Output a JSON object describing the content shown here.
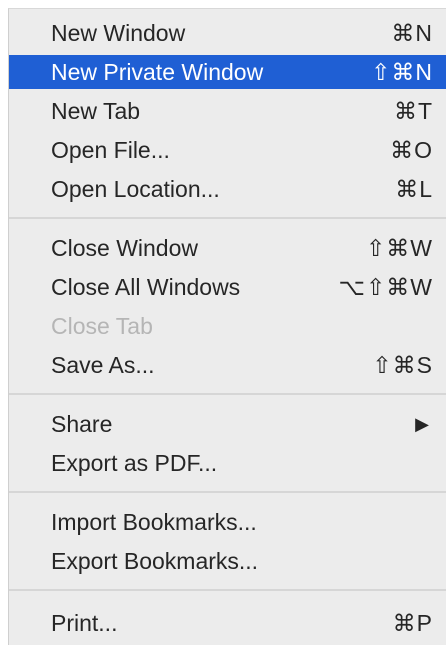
{
  "menu": {
    "group1": [
      {
        "label": "New Window",
        "shortcut": "⌘N"
      },
      {
        "label": "New Private Window",
        "shortcut": "⇧⌘N"
      },
      {
        "label": "New Tab",
        "shortcut": "⌘T"
      },
      {
        "label": "Open File...",
        "shortcut": "⌘O"
      },
      {
        "label": "Open Location...",
        "shortcut": "⌘L"
      }
    ],
    "group2": [
      {
        "label": "Close Window",
        "shortcut": "⇧⌘W"
      },
      {
        "label": "Close All Windows",
        "shortcut": "⌥⇧⌘W"
      },
      {
        "label": "Close Tab",
        "shortcut": ""
      },
      {
        "label": "Save As...",
        "shortcut": "⇧⌘S"
      }
    ],
    "group3": [
      {
        "label": "Share",
        "submenu_icon": "▶"
      },
      {
        "label": "Export as PDF..."
      }
    ],
    "group4": [
      {
        "label": "Import Bookmarks..."
      },
      {
        "label": "Export Bookmarks..."
      }
    ],
    "group5": [
      {
        "label": "Print...",
        "shortcut": "⌘P"
      }
    ],
    "highlighted_item": "New Private Window",
    "disabled_item": "Close Tab",
    "colors": {
      "highlight": "#1f5fd4",
      "background": "#ececec",
      "text": "#262626",
      "disabled_text": "#b5b5b5"
    }
  }
}
